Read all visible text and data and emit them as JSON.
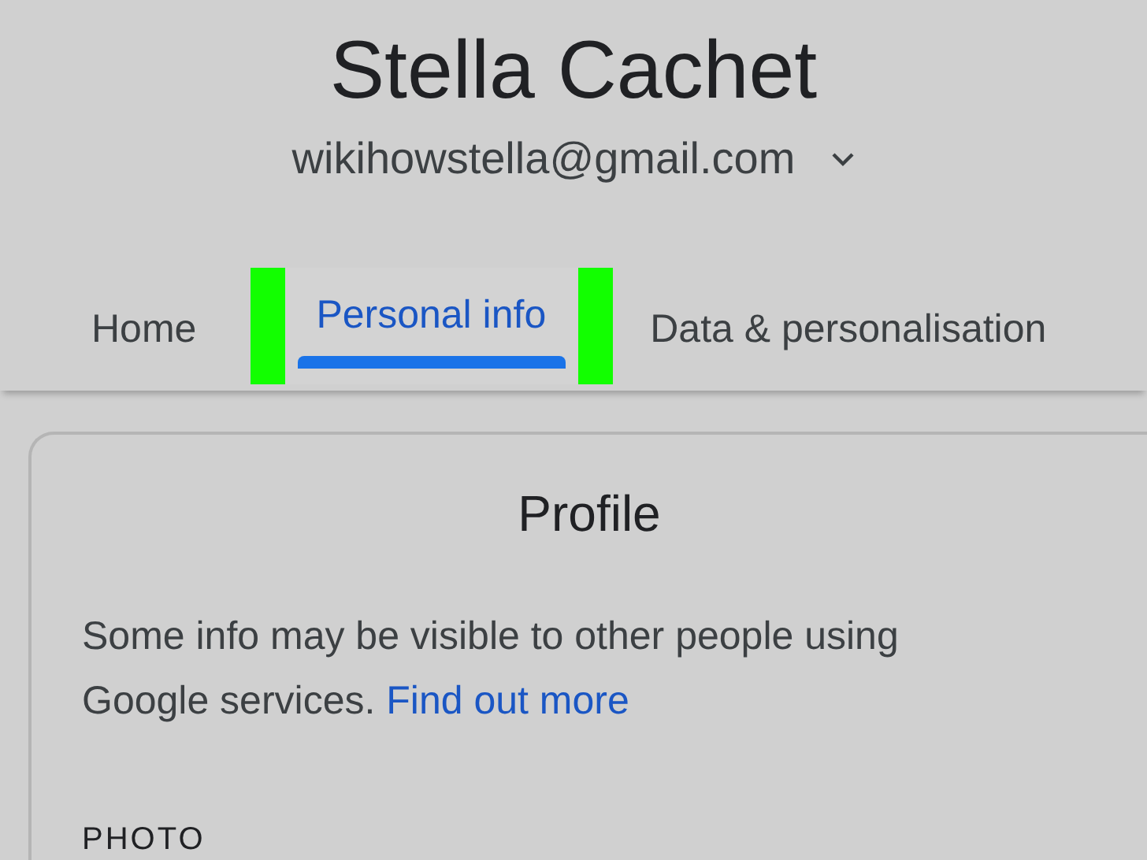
{
  "account": {
    "name": "Stella Cachet",
    "email": "wikihowstella@gmail.com"
  },
  "tabs": [
    {
      "label": "Home",
      "selected": false,
      "highlighted": false
    },
    {
      "label": "Personal info",
      "selected": true,
      "highlighted": true
    },
    {
      "label": "Data & personalisation",
      "selected": false,
      "highlighted": false
    }
  ],
  "profile": {
    "title": "Profile",
    "description": "Some info may be visible to other people using Google services.",
    "link": "Find out more",
    "section": "PHOTO"
  }
}
